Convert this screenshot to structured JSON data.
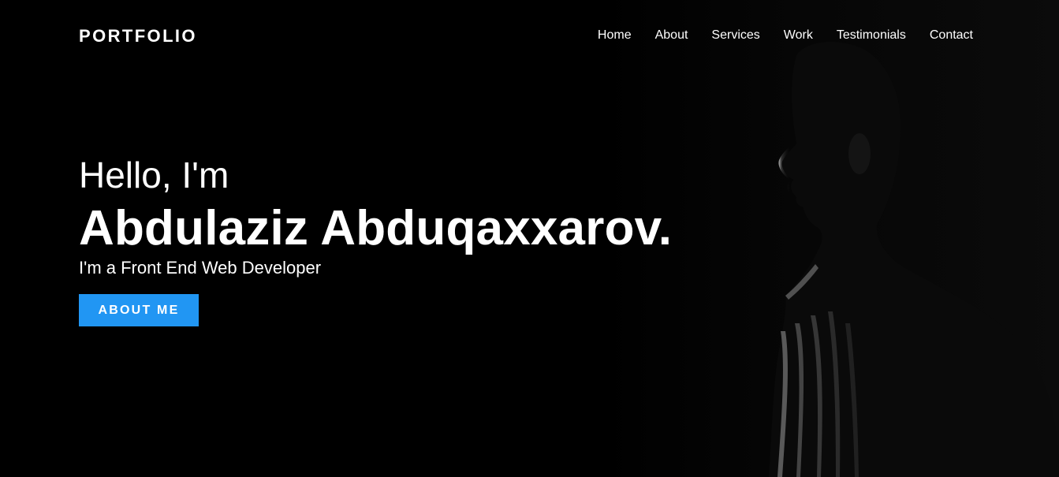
{
  "brand": {
    "label": "PORTFOLIO"
  },
  "nav": {
    "items": [
      {
        "label": "Home"
      },
      {
        "label": "About"
      },
      {
        "label": "Services"
      },
      {
        "label": "Work"
      },
      {
        "label": "Testimonials"
      },
      {
        "label": "Contact"
      }
    ]
  },
  "hero": {
    "greeting": "Hello, I'm",
    "name": "Abdulaziz Abduqaxxarov.",
    "role": "I'm a Front End Web Developer",
    "cta_label": "ABOUT ME"
  },
  "colors": {
    "background": "#000000",
    "text": "#ffffff",
    "accent": "#2196f3"
  },
  "image": {
    "subject": "portrait-silhouette"
  }
}
